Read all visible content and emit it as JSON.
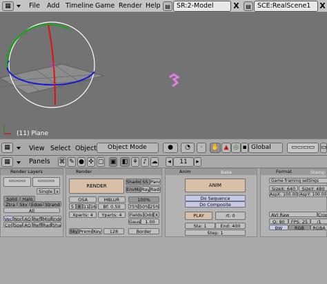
{
  "menu": {
    "file": "File",
    "add": "Add",
    "timeline": "Timeline",
    "game": "Game",
    "render": "Render",
    "help": "Help"
  },
  "screen": {
    "value": "SR:2-Model",
    "close": "X"
  },
  "scene": {
    "value": "SCE:RealScene1",
    "close": "X"
  },
  "viewport": {
    "object_label": "(11) Plane"
  },
  "header3d": {
    "view": "View",
    "select": "Select",
    "object": "Object",
    "mode": "Object Mode",
    "transform": "Global"
  },
  "buttons_header": {
    "panels": "Panels",
    "frame": "11"
  },
  "render_layers": {
    "title": "Render Layers",
    "single": "Single",
    "passes": [
      "Solid",
      "Halo",
      "Ztra",
      "Sky",
      "Edge",
      "Strand"
    ],
    "all": "All",
    "row2": [
      "Vec",
      "Nor",
      "AO",
      "Refl",
      "Mist",
      "Index"
    ],
    "row3": [
      "Col",
      "Spec",
      "AO",
      "Refl",
      "Rad",
      "Shad"
    ]
  },
  "render": {
    "title": "Render",
    "render_btn": "RENDER",
    "shadow": "Shado",
    "ss": "SS",
    "pano": "Pano",
    "envmap": "EnvMa",
    "ray": "Ray",
    "radio": "Radi",
    "osa": "OSA",
    "mblur": "MBLUR",
    "osa_vals": [
      "5",
      "8",
      "11",
      "16"
    ],
    "bf": "Bf: 0.50",
    "pct": "100%",
    "pct_vals": [
      "75%",
      "50%",
      "25%"
    ],
    "xparts": "Xparts: 4",
    "yparts": "Yparts: 4",
    "fields": "Fields",
    "odd": "Odd",
    "x": "X",
    "gauss": "Gauss",
    "gauss_val": "1.00",
    "sky": "Sky",
    "premul": "Premul",
    "key": "Key",
    "key_val": "128",
    "border": "Border"
  },
  "anim": {
    "tab1": "Anim",
    "tab2": "Bake",
    "anim_btn": "ANIM",
    "do_seq": "Do Sequence",
    "do_comp": "Do Composite",
    "play": "PLAY",
    "rt": "rt: 0",
    "sta": "Sta: 1",
    "end": "End: 400",
    "step": "Step: 1"
  },
  "format": {
    "tab1": "Format",
    "tab2": "Stamp",
    "preset": "Game framing settings",
    "sizex": "SizeX: 640",
    "sizey": "SizeY: 480",
    "aspx": "AspX: 100.00",
    "aspy": "AspY: 100.00",
    "codec": "AVI Raw",
    "crop": "Crop",
    "q": "Q: 90",
    "fps": "FPS: 25",
    "bw": "BW",
    "rgb": "RGB",
    "rgba": "RGBA"
  }
}
